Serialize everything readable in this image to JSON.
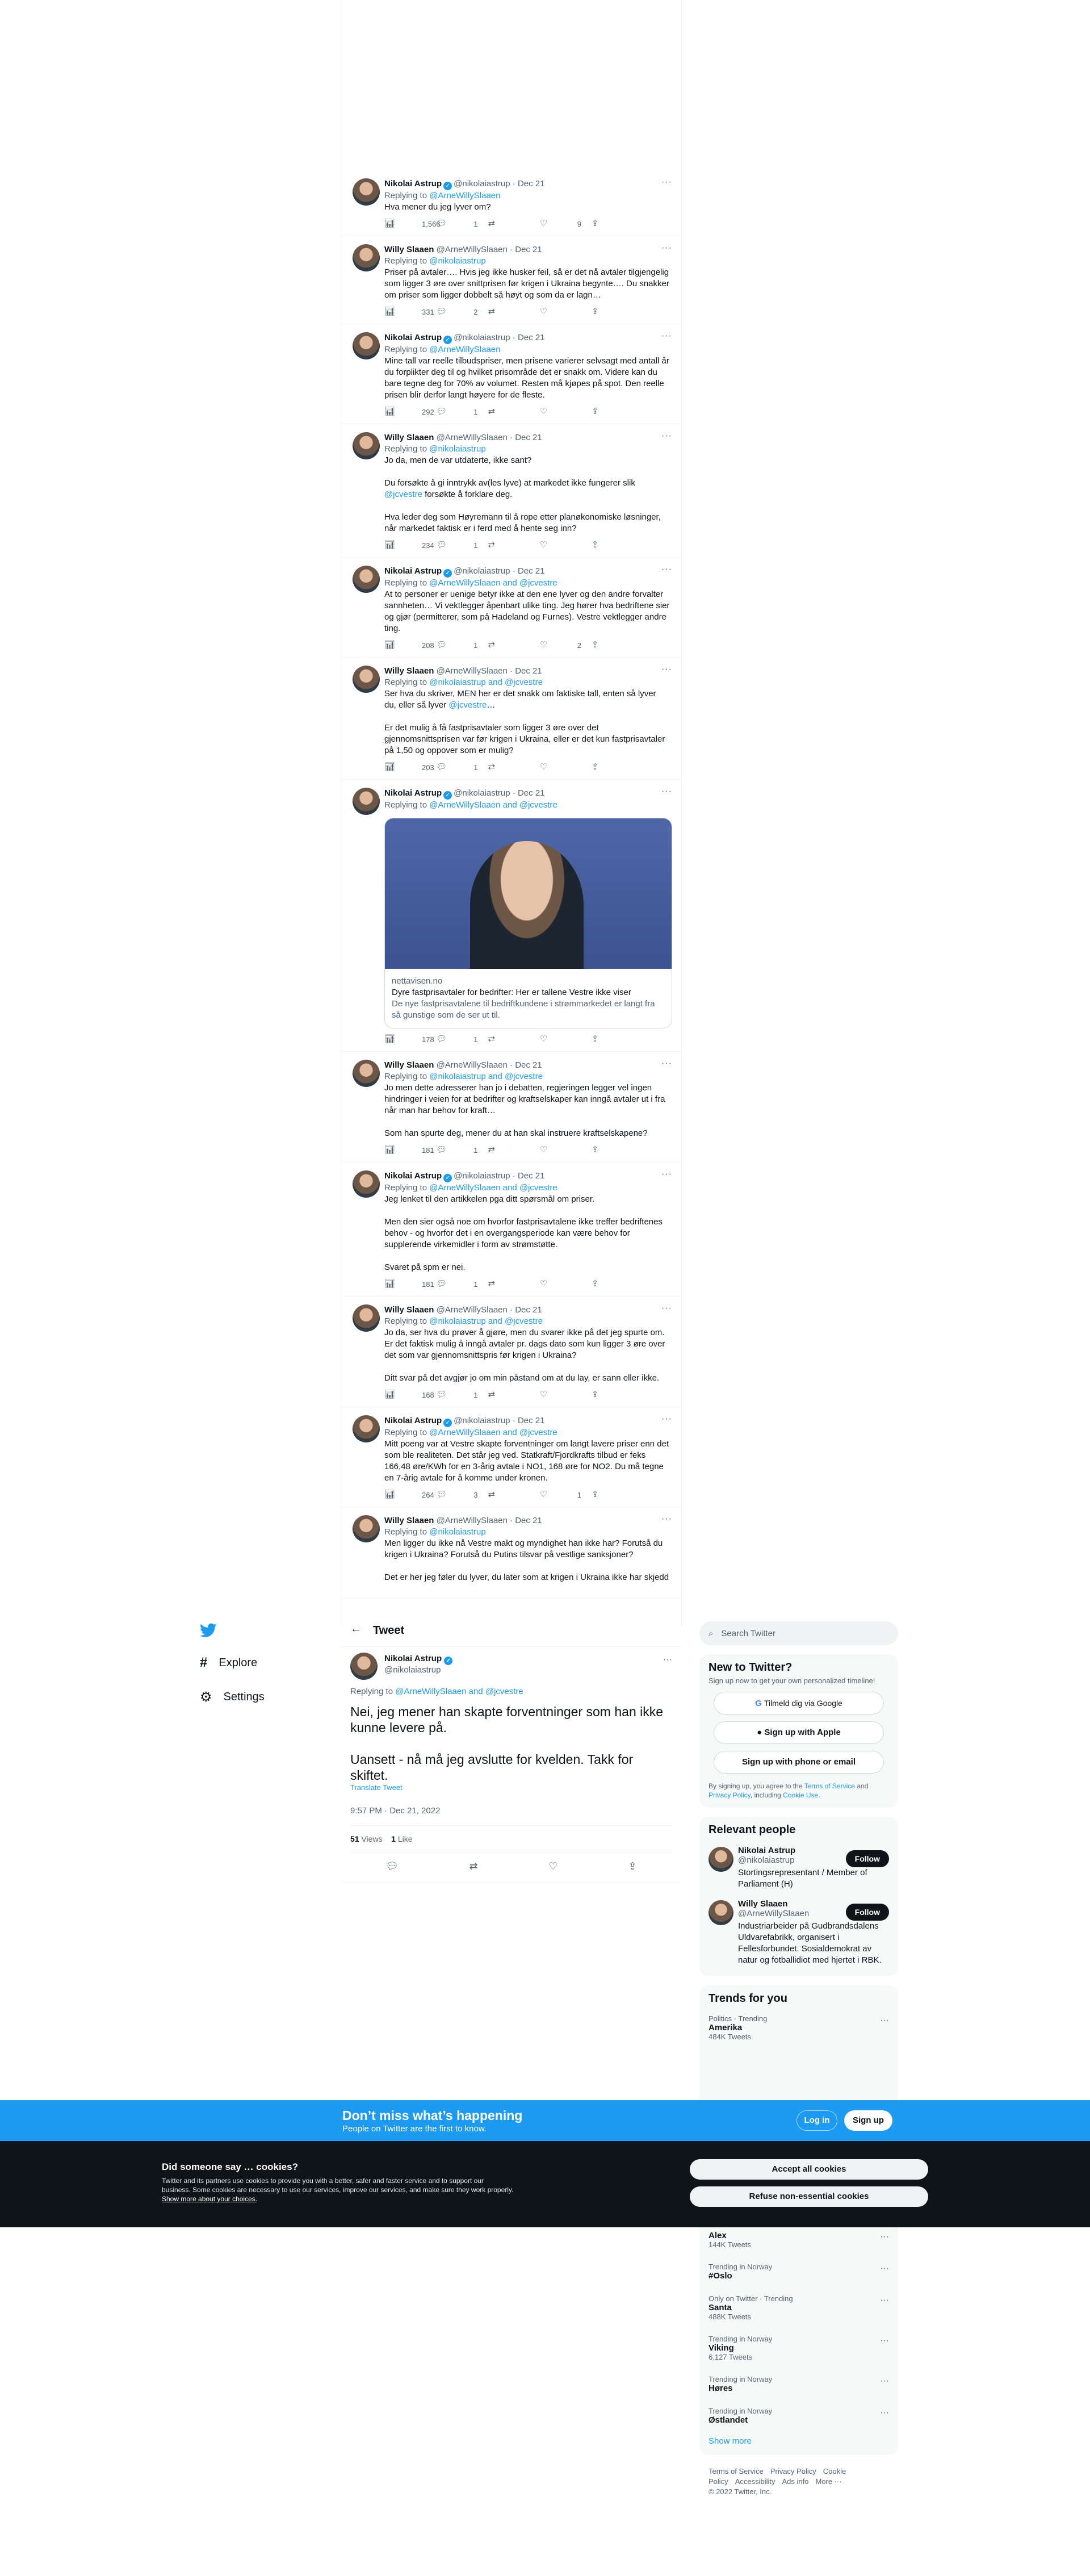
{
  "nav": {
    "explore": "Explore",
    "settings": "Settings"
  },
  "header": {
    "title": "Tweet"
  },
  "thread": [
    {
      "name": "Nikolai Astrup",
      "verified": true,
      "handle": "@nikolaiastrup",
      "date": "Dec 21",
      "reply_prefix": "Replying to ",
      "reply_to": "@ArneWillySlaaen",
      "text": "Hva mener du jeg lyver om?",
      "stats": {
        "views": "1,566",
        "replies": "1",
        "retweets": "",
        "likes": "9"
      }
    },
    {
      "name": "Willy Slaaen",
      "verified": false,
      "handle": "@ArneWillySlaaen",
      "date": "Dec 21",
      "reply_prefix": "Replying to ",
      "reply_to": "@nikolaiastrup",
      "text": "Priser på avtaler…. Hvis jeg ikke husker feil, så er det nå avtaler tilgjengelig som ligger 3 øre over snittprisen før krigen i Ukraina begynte…. Du snakker om priser som ligger dobbelt så høyt og som da er lagn…",
      "stats": {
        "views": "331",
        "replies": "2",
        "retweets": "",
        "likes": ""
      }
    },
    {
      "name": "Nikolai Astrup",
      "verified": true,
      "handle": "@nikolaiastrup",
      "date": "Dec 21",
      "reply_prefix": "Replying to ",
      "reply_to": "@ArneWillySlaaen",
      "text": "Mine tall var reelle tilbudspriser, men prisene varierer selvsagt med antall år du forplikter deg til og hvilket prisområde det er snakk om. Videre kan du bare tegne deg for 70% av volumet. Resten må kjøpes på spot. Den reelle prisen blir derfor langt høyere for de fleste.",
      "stats": {
        "views": "292",
        "replies": "1",
        "retweets": "",
        "likes": ""
      }
    },
    {
      "name": "Willy Slaaen",
      "verified": false,
      "handle": "@ArneWillySlaaen",
      "date": "Dec 21",
      "reply_prefix": "Replying to ",
      "reply_to": "@nikolaiastrup",
      "text_a": "Jo da, men de var utdaterte, ikke sant?\n\nDu forsøkte å gi inntrykk av(les lyve) at markedet ikke fungerer slik ",
      "mention": "@jcvestre",
      "text_b": " forsøkte å forklare deg.\n\nHva leder deg som Høyremann til å rope etter planøkonomiske løsninger, når markedet faktisk er i ferd med å hente seg inn?",
      "stats": {
        "views": "234",
        "replies": "1",
        "retweets": "",
        "likes": ""
      }
    },
    {
      "name": "Nikolai Astrup",
      "verified": true,
      "handle": "@nikolaiastrup",
      "date": "Dec 21",
      "reply_prefix": "Replying to ",
      "reply_to": "@ArneWillySlaaen and @jcvestre",
      "text": "At to personer er uenige betyr ikke at den ene lyver og den andre forvalter sannheten… Vi vektlegger åpenbart ulike ting. Jeg hører hva bedriftene sier og gjør (permitterer, som på Hadeland og Furnes). Vestre vektlegger andre ting.",
      "stats": {
        "views": "208",
        "replies": "1",
        "retweets": "",
        "likes": "2"
      }
    },
    {
      "name": "Willy Slaaen",
      "verified": false,
      "handle": "@ArneWillySlaaen",
      "date": "Dec 21",
      "reply_prefix": "Replying to ",
      "reply_to": "@nikolaiastrup and @jcvestre",
      "text_a": "Ser hva du skriver, MEN her er det snakk om faktiske tall, enten så lyver du, eller så lyver ",
      "mention": "@jcvestre",
      "text_b": "…\n\nEr det mulig å få fastprisavtaler som ligger 3 øre over det gjennomsnittsprisen var før krigen i Ukraina, eller er det kun fastprisavtaler på 1,50 og oppover som er mulig?",
      "stats": {
        "views": "203",
        "replies": "1",
        "retweets": "",
        "likes": ""
      }
    },
    {
      "name": "Nikolai Astrup",
      "verified": true,
      "handle": "@nikolaiastrup",
      "date": "Dec 21",
      "reply_prefix": "Replying to ",
      "reply_to": "@ArneWillySlaaen and @jcvestre",
      "text": "",
      "card": {
        "domain": "nettavisen.no",
        "title": "Dyre fastprisavtaler for bedrifter: Her er tallene Vestre ikke viser",
        "desc": "De nye fastprisavtalene til bedriftkundene i strømmarkedet er langt fra så gunstige som de ser ut til."
      },
      "stats": {
        "views": "178",
        "replies": "1",
        "retweets": "",
        "likes": ""
      }
    },
    {
      "name": "Willy Slaaen",
      "verified": false,
      "handle": "@ArneWillySlaaen",
      "date": "Dec 21",
      "reply_prefix": "Replying to ",
      "reply_to": "@nikolaiastrup and @jcvestre",
      "text": "Jo men dette adresserer han jo i debatten, regjeringen legger vel ingen hindringer i veien for at bedrifter og kraftselskaper kan inngå avtaler ut i fra når man har behov for kraft…\n\nSom han spurte deg, mener du at han skal instruere kraftselskapene?",
      "stats": {
        "views": "181",
        "replies": "1",
        "retweets": "",
        "likes": ""
      }
    },
    {
      "name": "Nikolai Astrup",
      "verified": true,
      "handle": "@nikolaiastrup",
      "date": "Dec 21",
      "reply_prefix": "Replying to ",
      "reply_to": "@ArneWillySlaaen and @jcvestre",
      "text": "Jeg lenket til den artikkelen pga ditt spørsmål om priser.\n\nMen den sier også noe om hvorfor fastprisavtalene ikke treffer bedriftenes behov - og hvorfor det i en overgangsperiode kan være behov for supplerende virkemidler i form av strømstøtte.\n\nSvaret på spm er nei.",
      "stats": {
        "views": "181",
        "replies": "1",
        "retweets": "",
        "likes": ""
      }
    },
    {
      "name": "Willy Slaaen",
      "verified": false,
      "handle": "@ArneWillySlaaen",
      "date": "Dec 21",
      "reply_prefix": "Replying to ",
      "reply_to": "@nikolaiastrup and @jcvestre",
      "text": "Jo da, ser hva du prøver å gjøre, men du svarer ikke på det jeg spurte om. Er det faktisk mulig å inngå avtaler pr. dags dato som kun ligger 3 øre over det som var gjennomsnittspris før krigen i Ukraina?\n\nDitt svar på det avgjør jo om min påstand om at du lay, er sann eller ikke.",
      "stats": {
        "views": "168",
        "replies": "1",
        "retweets": "",
        "likes": ""
      }
    },
    {
      "name": "Nikolai Astrup",
      "verified": true,
      "handle": "@nikolaiastrup",
      "date": "Dec 21",
      "reply_prefix": "Replying to ",
      "reply_to": "@ArneWillySlaaen and @jcvestre",
      "text": "Mitt poeng var at Vestre skapte forventninger om langt lavere priser enn det som ble realiteten. Det står jeg ved. Statkraft/Fjordkrafts tilbud er feks 166,48 øre/KWh for en 3-årig avtale i NO1, 168 øre for NO2. Du må tegne en 7-årig avtale for å komme under kronen.",
      "stats": {
        "views": "264",
        "replies": "3",
        "retweets": "",
        "likes": "1"
      }
    },
    {
      "name": "Willy Slaaen",
      "verified": false,
      "handle": "@ArneWillySlaaen",
      "date": "Dec 21",
      "reply_prefix": "Replying to ",
      "reply_to": "@nikolaiastrup",
      "text": "Men ligger du ikke nå Vestre makt og myndighet han ikke har? Forutså du krigen i Ukraina? Forutså du Putins tilsvar på vestlige sanksjoner?\n\nDet er her jeg føler du lyver, du later som at krigen i Ukraina ikke har skjedd",
      "stats": {
        "views": "",
        "replies": "",
        "retweets": "",
        "likes": ""
      }
    }
  ],
  "main": {
    "name": "Nikolai Astrup",
    "handle": "@nikolaiastrup",
    "reply_prefix": "Replying to ",
    "reply_to": "@ArneWillySlaaen and @jcvestre",
    "text": "Nei, jeg mener han skapte forventninger som han ikke kunne levere på.\n\nUansett - nå må jeg avslutte for kvelden. Takk for skiftet.",
    "translate": "Translate Tweet",
    "time": "9:57 PM · Dec 21, 2022",
    "views_n": "51",
    "views_l": "Views",
    "likes_n": "1",
    "likes_l": "Like"
  },
  "search": {
    "placeholder": "Search Twitter"
  },
  "new_to": {
    "title": "New to Twitter?",
    "sub": "Sign up now to get your own personalized timeline!",
    "google": "Tilmeld dig via Google",
    "apple": "Sign up with Apple",
    "phone": "Sign up with phone or email",
    "legal_a": "By signing up, you agree to the ",
    "tos": "Terms of Service",
    "legal_b": " and ",
    "pp": "Privacy Policy",
    "legal_c": ", including ",
    "cu": "Cookie Use",
    "legal_d": "."
  },
  "relevant": {
    "title": "Relevant people",
    "follow": "Follow",
    "people": [
      {
        "name": "Nikolai Astrup",
        "handle": "@nikolaiastrup",
        "bio": "Stortingsrepresentant / Member of Parliament (H)"
      },
      {
        "name": "Willy Slaaen",
        "handle": "@ArneWillySlaaen",
        "bio": "Industriarbeider på Gudbrandsdalens Uldvarefabrikk, organisert i Fellesforbundet. Sosialdemokrat av natur og fotballidiot med hjertet i RBK."
      }
    ]
  },
  "trends": {
    "title": "Trends for you",
    "items": [
      {
        "ctx": "Politics · Trending",
        "name": "Amerika",
        "count": "484K Tweets"
      },
      {
        "ctx": "",
        "name": "Alex",
        "count": "144K Tweets"
      },
      {
        "ctx": "Trending in Norway",
        "name": "#Oslo",
        "count": ""
      },
      {
        "ctx": "Only on Twitter · Trending",
        "name": "Santa",
        "count": "488K Tweets"
      },
      {
        "ctx": "Trending in Norway",
        "name": "Viking",
        "count": "6,127 Tweets"
      },
      {
        "ctx": "Trending in Norway",
        "name": "Høres",
        "count": ""
      },
      {
        "ctx": "Trending in Norway",
        "name": "Østlandet",
        "count": ""
      }
    ],
    "show_more": "Show more"
  },
  "footer": {
    "links": [
      "Terms of Service",
      "Privacy Policy",
      "Cookie Policy",
      "Accessibility",
      "Ads info",
      "More ···"
    ],
    "copy": "© 2022 Twitter, Inc."
  },
  "banner": {
    "title": "Don’t miss what’s happening",
    "sub": "People on Twitter are the first to know.",
    "login": "Log in",
    "signup": "Sign up"
  },
  "cookie": {
    "title": "Did someone say … cookies?",
    "body": "Twitter and its partners use cookies to provide you with a better, safer and faster service and to support our business. Some cookies are necessary to use our services, improve our services, and make sure they work properly. ",
    "link": "Show more about your choices.",
    "accept": "Accept all cookies",
    "refuse": "Refuse non-essential cookies"
  },
  "colors": {
    "accent": "#1d9bf0",
    "dark": "#0f1419",
    "muted": "#536471"
  }
}
